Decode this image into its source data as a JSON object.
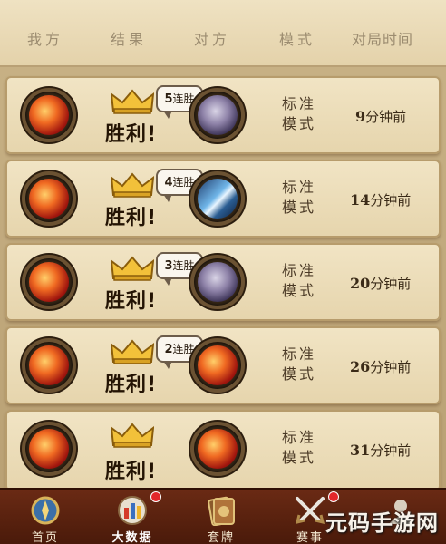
{
  "header": {
    "columns": [
      "我方",
      "结果",
      "对方",
      "模式",
      "对局时间"
    ]
  },
  "matches": [
    {
      "my_hero": "mage-hero-icon",
      "result": "胜利!",
      "streak_num": "5",
      "streak_text": "连胜",
      "opp_hero": "priest-hero-icon",
      "mode_line1": "标准",
      "mode_line2": "模式",
      "time_num": "9",
      "time_unit": "分钟前"
    },
    {
      "my_hero": "mage-hero-icon",
      "result": "胜利!",
      "streak_num": "4",
      "streak_text": "连胜",
      "opp_hero": "warrior-hero-icon",
      "mode_line1": "标准",
      "mode_line2": "模式",
      "time_num": "14",
      "time_unit": "分钟前"
    },
    {
      "my_hero": "mage-hero-icon",
      "result": "胜利!",
      "streak_num": "3",
      "streak_text": "连胜",
      "opp_hero": "priest-hero-icon",
      "mode_line1": "标准",
      "mode_line2": "模式",
      "time_num": "20",
      "time_unit": "分钟前"
    },
    {
      "my_hero": "mage-hero-icon",
      "result": "胜利!",
      "streak_num": "2",
      "streak_text": "连胜",
      "opp_hero": "mage-hero-icon",
      "mode_line1": "标准",
      "mode_line2": "模式",
      "time_num": "26",
      "time_unit": "分钟前"
    },
    {
      "my_hero": "mage-hero-icon",
      "result": "胜利!",
      "streak_num": "",
      "streak_text": "",
      "opp_hero": "mage-hero-icon",
      "mode_line1": "标准",
      "mode_line2": "模式",
      "time_num": "31",
      "time_unit": "分钟前"
    }
  ],
  "tabbar": {
    "tabs": [
      {
        "label": "首页",
        "icon": "home-icon",
        "badge": false
      },
      {
        "label": "大数据",
        "icon": "stats-icon",
        "badge": true
      },
      {
        "label": "套牌",
        "icon": "deck-icon",
        "badge": false
      },
      {
        "label": "赛事",
        "icon": "crossed-swords-icon",
        "badge": true
      },
      {
        "label": "",
        "icon": "profile-icon",
        "badge": false
      }
    ]
  },
  "watermark": "元码手游网",
  "colors": {
    "accent": "#e3262a",
    "victory_text": "#241404",
    "gold": "#f2c13a"
  }
}
